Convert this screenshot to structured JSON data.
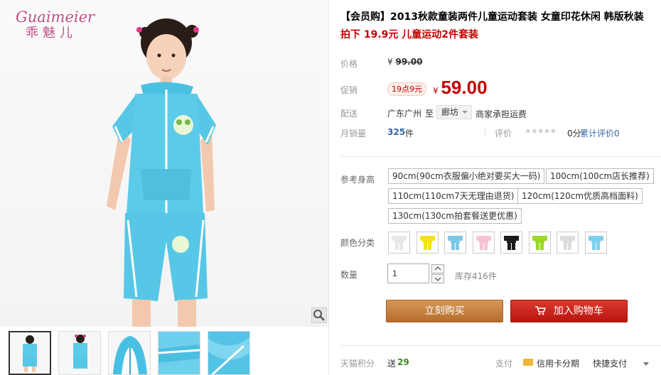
{
  "brand": {
    "latin": "Guaimeier",
    "cn": "乖魅儿"
  },
  "product": {
    "title": "【会员购】2013秋款童装两件儿童运动套装 女童印花休闲 韩版秋装",
    "promo_line": "拍下 19.9元 儿童运动2件套装"
  },
  "price": {
    "label": "价格",
    "currency": "¥",
    "original": "99.00"
  },
  "promo": {
    "label": "促销",
    "badge": "19点9元",
    "currency": "¥",
    "price": "59.00"
  },
  "shipping": {
    "label": "配送",
    "from": "广东广州",
    "to_word": "至",
    "to_city": "廊坊",
    "note": "商家承担运费"
  },
  "sales": {
    "label": "月销量",
    "count": "325",
    "unit": "件",
    "review_label": "评价",
    "stars": "★★★★★",
    "score": "0分",
    "cumulative": "累计评价0"
  },
  "sizes": {
    "label": "参考身高",
    "options": [
      "90cm(90cm衣服偏小绝对要买大一码)",
      "100cm(100cm店长推荐)",
      "110cm(110cm7天无理由退货)",
      "120cm(120cm优质高档面料)",
      "130cm(130cm拍套餐送更优惠)"
    ]
  },
  "colors": {
    "label": "颜色分类",
    "swatches": [
      "#e8e8e8",
      "#f2e21a",
      "#7ec8e6",
      "#f7c3d3",
      "#1a1a1a",
      "#9bd82a",
      "#dddddd",
      "#7fd0ee"
    ]
  },
  "quantity": {
    "label": "数量",
    "value": "1",
    "stock": "库存416件"
  },
  "actions": {
    "buy_now": "立刻购买",
    "add_to_cart": "加入购物车"
  },
  "footer": {
    "points_label": "天猫积分",
    "points_prefix": "送",
    "points_value": "29",
    "pay_label": "支付",
    "pay_method": "信用卡分期",
    "quick_pay": "快捷支付"
  },
  "colors_theme": {
    "accent_red": "#c40000",
    "buy_orange": "#c8813f",
    "cart_red": "#c8201a"
  }
}
